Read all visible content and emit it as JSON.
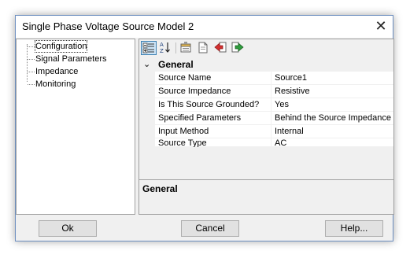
{
  "window": {
    "title": "Single Phase Voltage Source Model 2",
    "close_glyph": "✕"
  },
  "tree": {
    "items": [
      {
        "label": "Configuration",
        "selected": true
      },
      {
        "label": "Signal Parameters",
        "selected": false
      },
      {
        "label": "Impedance",
        "selected": false
      },
      {
        "label": "Monitoring",
        "selected": false
      }
    ]
  },
  "toolbar": {
    "buttons": [
      {
        "icon": "categorized-view-icon",
        "active": true
      },
      {
        "icon": "sort-alphabetical-icon",
        "active": false
      },
      {
        "icon": "property-pages-icon",
        "active": false
      },
      {
        "icon": "new-document-icon",
        "active": false
      },
      {
        "icon": "import-icon",
        "active": false
      },
      {
        "icon": "export-icon",
        "active": false
      }
    ]
  },
  "grid": {
    "category": "General",
    "rows": [
      {
        "name": "Source Name",
        "value": "Source1"
      },
      {
        "name": "Source Impedance",
        "value": "Resistive"
      },
      {
        "name": "Is This Source Grounded?",
        "value": "Yes"
      },
      {
        "name": "Specified Parameters",
        "value": "Behind the Source Impedance"
      },
      {
        "name": "Input Method",
        "value": "Internal"
      },
      {
        "name": "Source Type",
        "value": "AC"
      }
    ]
  },
  "description": {
    "title": "General"
  },
  "buttons": {
    "ok": "Ok",
    "cancel": "Cancel",
    "help": "Help..."
  },
  "colors": {
    "accent_border": "#6c8ebf",
    "selected_tool_bg": "#cce4f7",
    "panel_bg": "#f0f0f0"
  }
}
